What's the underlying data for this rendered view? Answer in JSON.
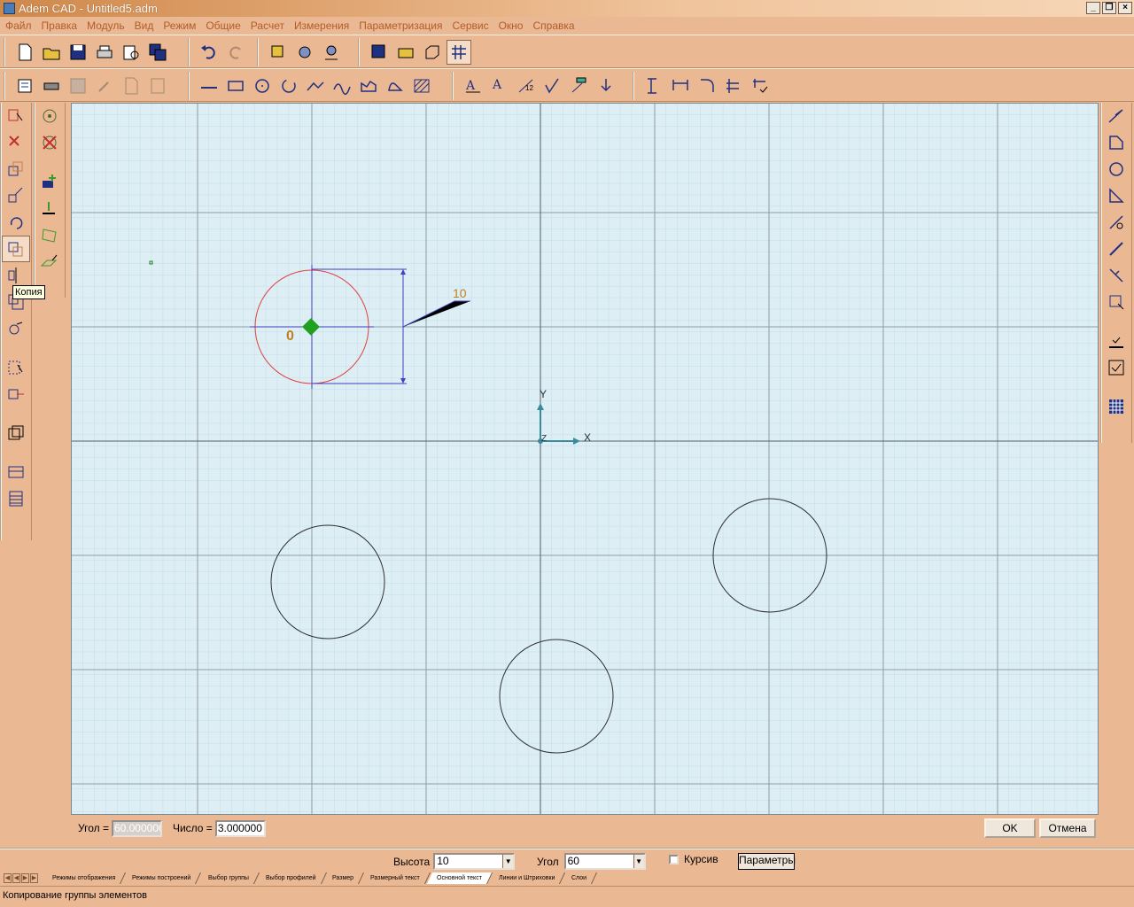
{
  "window": {
    "title": "Adem CAD - Untitled5.adm",
    "buttons": [
      "_",
      "❐",
      "×"
    ]
  },
  "menu": [
    "Файл",
    "Правка",
    "Модуль",
    "Вид",
    "Режим",
    "Общие",
    "Расчет",
    "Измерения",
    "Параметризация",
    "Сервис",
    "Окно",
    "Справка"
  ],
  "tooltip": "Копия",
  "canvas": {
    "dimension_label": "10",
    "point_label": "0",
    "axis_x": "X",
    "axis_y": "Y",
    "axis_z": "Z"
  },
  "params": {
    "angle_label": "Угол =",
    "angle_value": "60.000000",
    "count_label": "Число =",
    "count_value": "3.000000",
    "ok": "OK",
    "cancel": "Отмена"
  },
  "style": {
    "height_label": "Высота",
    "height_value": "10",
    "angle_label": "Угол",
    "angle_value": "60",
    "italic_label": "Курсив",
    "params_button": "Параметры"
  },
  "tabs": [
    "Режимы отображения",
    "Режимы построений",
    "Выбор группы",
    "Выбор профилей",
    "Размер",
    "Размерный текст",
    "Основной текст",
    "Линии и Штриховки",
    "Слои"
  ],
  "active_tab": "Основной текст",
  "status": "Копирование группы элементов",
  "colors": {
    "bg": "#ebb894",
    "canvas": "#ddeef5",
    "grid_major": "#8e9ea4",
    "grid_minor": "#c4dde6",
    "selected": "#e04040",
    "dimension": "#4040c0",
    "label": "#c08020",
    "marker": "#20a020",
    "menu_text": "#b05d28"
  }
}
